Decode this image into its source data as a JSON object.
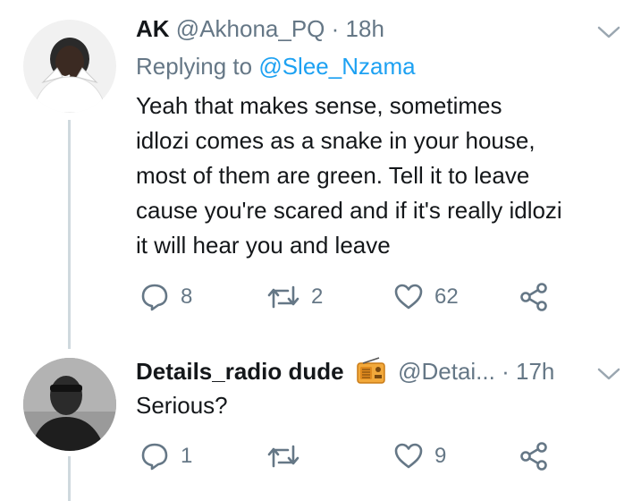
{
  "tweets": [
    {
      "name": "AK",
      "handle": "@Akhona_PQ",
      "separator": "·",
      "time": "18h",
      "replying_label": "Replying to",
      "replying_to": "@Slee_Nzama",
      "text": "Yeah that makes sense, sometimes\nidlozi comes as a snake in your house,\nmost of them are green. Tell it to leave\ncause you're scared and if it's really idlozi\nit will hear you and leave",
      "replies": "8",
      "retweets": "2",
      "likes": "62"
    },
    {
      "name": "Details_radio dude",
      "handle": "@Detai...",
      "separator": "·",
      "time": "17h",
      "text": "Serious?",
      "replies": "1",
      "retweets": "",
      "likes": "9"
    }
  ],
  "icons": {
    "reply": "reply-icon",
    "retweet": "retweet-icon",
    "like": "heart-icon",
    "share": "share-icon",
    "more": "chevron-down-icon",
    "radio": "radio-emoji-icon"
  },
  "colors": {
    "text": "#14171a",
    "muted": "#657786",
    "link": "#1da1f2",
    "thread_line": "#cfd9de"
  }
}
